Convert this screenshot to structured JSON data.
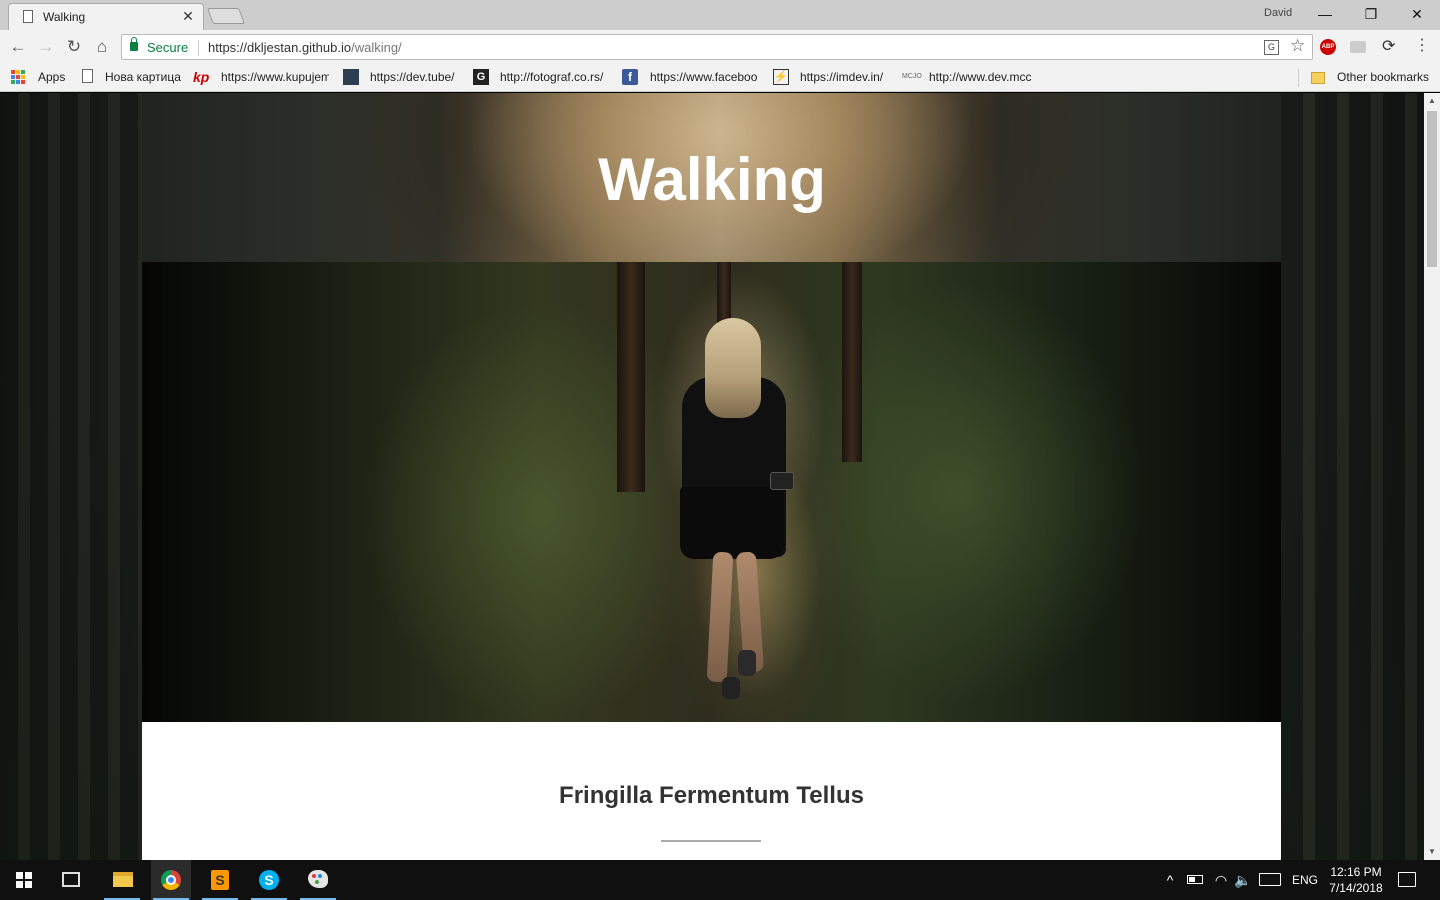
{
  "browser": {
    "tab": {
      "title": "Walking",
      "close": "✕"
    },
    "profile_name": "David",
    "window_controls": {
      "minimize": "—",
      "maximize": "❐",
      "close": "✕"
    },
    "nav": {
      "back": "←",
      "forward": "→",
      "reload": "↻",
      "home": "⌂"
    },
    "omnibox": {
      "secure_label": "Secure",
      "url_scheme_host": "https://dkljestan.github.io",
      "url_path": "/walking/"
    },
    "extensions": {
      "abp": "ABP",
      "star": "☆",
      "menu": "⋮",
      "translate": "G",
      "sync": "⟳"
    }
  },
  "bookmarks": {
    "items": [
      {
        "label": "Apps",
        "icon": "apps-icon"
      },
      {
        "label": "Нова картица",
        "icon": "page-icon"
      },
      {
        "label": "https://www.kupujem",
        "icon": "kp-icon",
        "icon_text": "kp"
      },
      {
        "label": "https://dev.tube/",
        "icon": "devtube-icon"
      },
      {
        "label": "http://fotograf.co.rs/",
        "icon": "g-icon",
        "icon_text": "G"
      },
      {
        "label": "https://www.faceboo",
        "icon": "facebook-icon",
        "icon_text": "f"
      },
      {
        "label": "https://imdev.in/",
        "icon": "bolt-icon",
        "icon_text": "⚡"
      },
      {
        "label": "http://www.dev.mcc",
        "icon": "mcc-icon",
        "icon_text": "MCJO"
      }
    ],
    "other": {
      "label": "Other bookmarks",
      "icon": "folder-icon"
    }
  },
  "page": {
    "title": "Walking",
    "section_heading": "Fringilla Fermentum Tellus"
  },
  "taskbar": {
    "apps": [
      {
        "name": "file-explorer",
        "active": false
      },
      {
        "name": "chrome",
        "active": true
      },
      {
        "name": "sublime-text",
        "active": false,
        "icon_text": "S"
      },
      {
        "name": "skype",
        "active": false,
        "icon_text": "S"
      },
      {
        "name": "paint",
        "active": false
      }
    ],
    "tray": {
      "chevron": "^",
      "wifi": "◠",
      "volume": "🔈",
      "language": "ENG",
      "time": "12:16 PM",
      "date": "7/14/2018"
    }
  },
  "colors": {
    "secure_green": "#0b8043",
    "taskbar_bg": "#101010",
    "taskbar_accent": "#76b9ed",
    "page_title": "#ffffff",
    "heading_text": "#333333"
  }
}
